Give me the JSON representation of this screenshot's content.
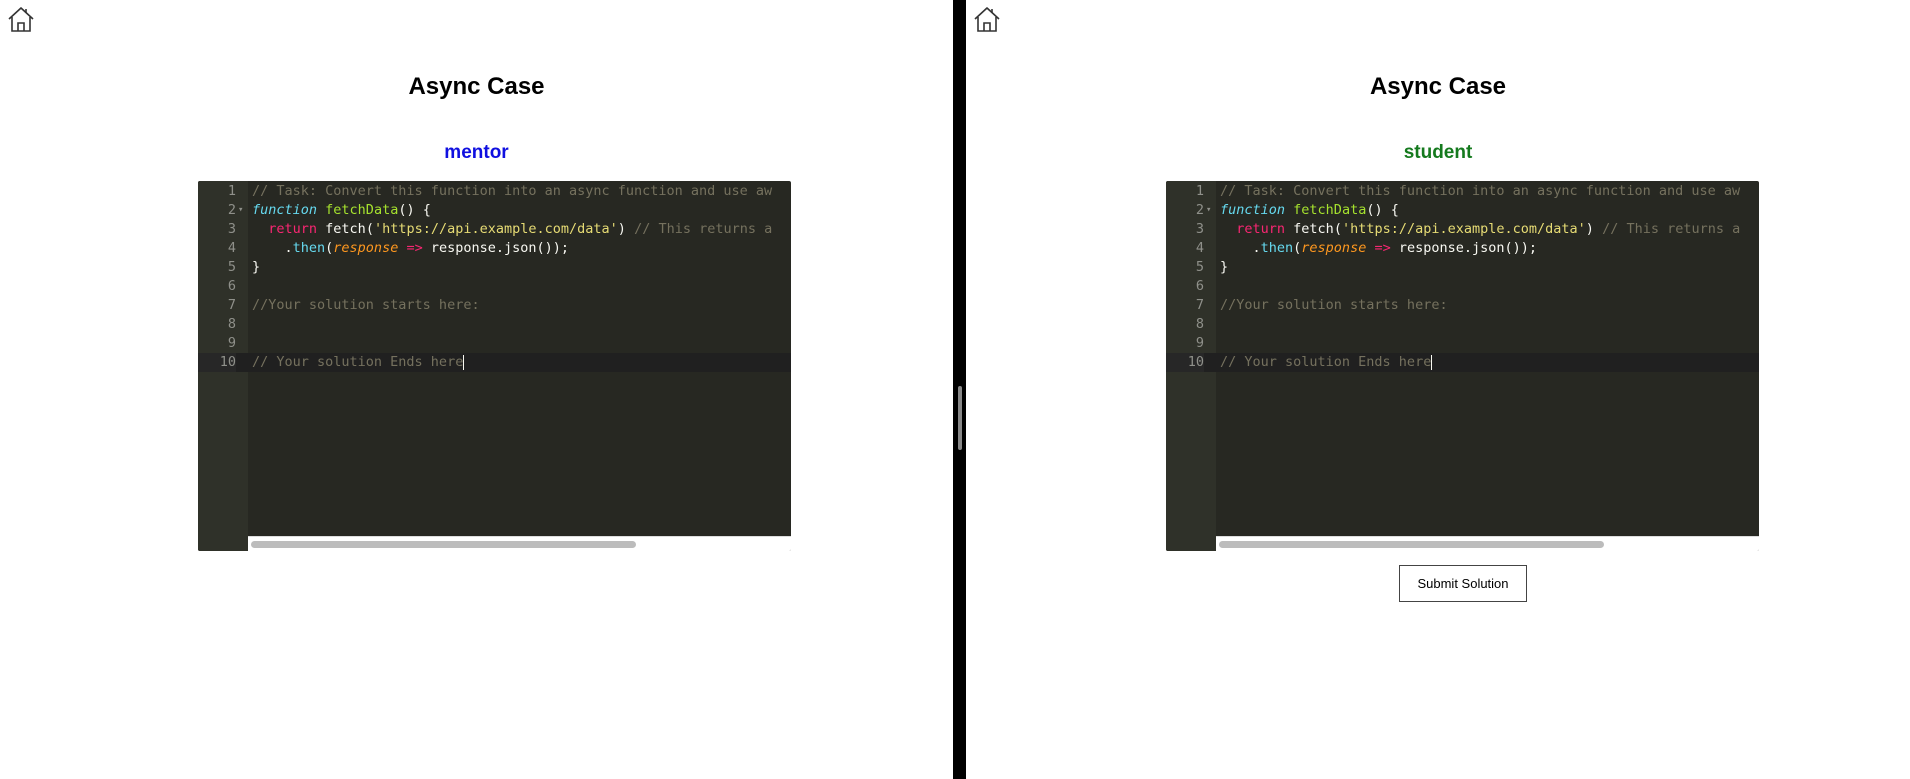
{
  "mentor_panel": {
    "title": "Async Case",
    "role": "mentor",
    "code_lines": [
      "// Task: Convert this function into an async function and use aw",
      "function fetchData() {",
      "  return fetch('https://api.example.com/data') // This returns a",
      "    .then(response => response.json());",
      "}",
      "",
      "//Your solution starts here:",
      "",
      "",
      "// Your solution Ends here"
    ]
  },
  "student_panel": {
    "title": "Async Case",
    "role": "student",
    "submit_label": "Submit Solution",
    "code_lines": [
      "// Task: Convert this function into an async function and use aw",
      "function fetchData() {",
      "  return fetch('https://api.example.com/data') // This returns a",
      "    .then(response => response.json());",
      "}",
      "",
      "//Your solution starts here:",
      "",
      "",
      "// Your solution Ends here"
    ]
  },
  "line_numbers": [
    "1",
    "2",
    "3",
    "4",
    "5",
    "6",
    "7",
    "8",
    "9",
    "10"
  ],
  "icons": {
    "home": "home-icon",
    "fold": "fold-arrow-icon"
  },
  "colors": {
    "mentor": "#1010e0",
    "student": "#157a1e",
    "editor_bg": "#272822",
    "comment": "#75715e",
    "keyword": "#66d9ef",
    "function_name": "#a6e22e",
    "string": "#e6db74",
    "return": "#f92672",
    "param": "#fd971f"
  }
}
